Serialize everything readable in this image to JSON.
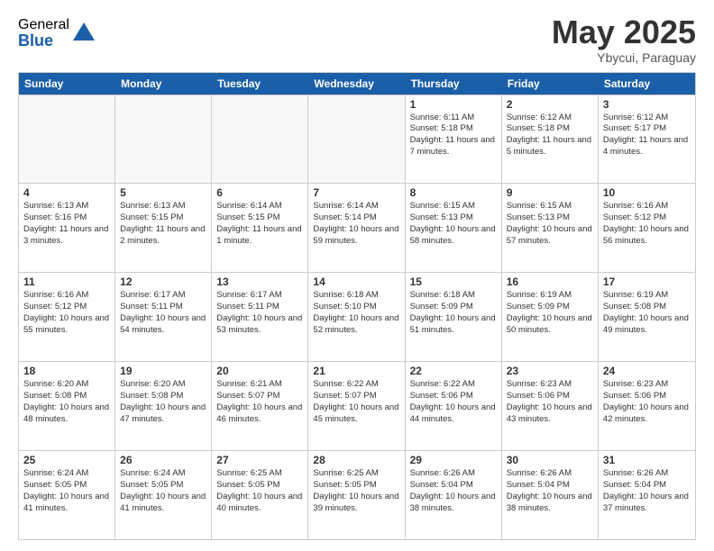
{
  "logo": {
    "general": "General",
    "blue": "Blue"
  },
  "title": "May 2025",
  "subtitle": "Ybycui, Paraguay",
  "header_days": [
    "Sunday",
    "Monday",
    "Tuesday",
    "Wednesday",
    "Thursday",
    "Friday",
    "Saturday"
  ],
  "weeks": [
    [
      {
        "day": "",
        "empty": true
      },
      {
        "day": "",
        "empty": true
      },
      {
        "day": "",
        "empty": true
      },
      {
        "day": "",
        "empty": true
      },
      {
        "day": "1",
        "sunrise": "6:11 AM",
        "sunset": "5:18 PM",
        "daylight": "11 hours and 7 minutes."
      },
      {
        "day": "2",
        "sunrise": "6:12 AM",
        "sunset": "5:18 PM",
        "daylight": "11 hours and 5 minutes."
      },
      {
        "day": "3",
        "sunrise": "6:12 AM",
        "sunset": "5:17 PM",
        "daylight": "11 hours and 4 minutes."
      }
    ],
    [
      {
        "day": "4",
        "sunrise": "6:13 AM",
        "sunset": "5:16 PM",
        "daylight": "11 hours and 3 minutes."
      },
      {
        "day": "5",
        "sunrise": "6:13 AM",
        "sunset": "5:15 PM",
        "daylight": "11 hours and 2 minutes."
      },
      {
        "day": "6",
        "sunrise": "6:14 AM",
        "sunset": "5:15 PM",
        "daylight": "11 hours and 1 minute."
      },
      {
        "day": "7",
        "sunrise": "6:14 AM",
        "sunset": "5:14 PM",
        "daylight": "10 hours and 59 minutes."
      },
      {
        "day": "8",
        "sunrise": "6:15 AM",
        "sunset": "5:13 PM",
        "daylight": "10 hours and 58 minutes."
      },
      {
        "day": "9",
        "sunrise": "6:15 AM",
        "sunset": "5:13 PM",
        "daylight": "10 hours and 57 minutes."
      },
      {
        "day": "10",
        "sunrise": "6:16 AM",
        "sunset": "5:12 PM",
        "daylight": "10 hours and 56 minutes."
      }
    ],
    [
      {
        "day": "11",
        "sunrise": "6:16 AM",
        "sunset": "5:12 PM",
        "daylight": "10 hours and 55 minutes."
      },
      {
        "day": "12",
        "sunrise": "6:17 AM",
        "sunset": "5:11 PM",
        "daylight": "10 hours and 54 minutes."
      },
      {
        "day": "13",
        "sunrise": "6:17 AM",
        "sunset": "5:11 PM",
        "daylight": "10 hours and 53 minutes."
      },
      {
        "day": "14",
        "sunrise": "6:18 AM",
        "sunset": "5:10 PM",
        "daylight": "10 hours and 52 minutes."
      },
      {
        "day": "15",
        "sunrise": "6:18 AM",
        "sunset": "5:09 PM",
        "daylight": "10 hours and 51 minutes."
      },
      {
        "day": "16",
        "sunrise": "6:19 AM",
        "sunset": "5:09 PM",
        "daylight": "10 hours and 50 minutes."
      },
      {
        "day": "17",
        "sunrise": "6:19 AM",
        "sunset": "5:08 PM",
        "daylight": "10 hours and 49 minutes."
      }
    ],
    [
      {
        "day": "18",
        "sunrise": "6:20 AM",
        "sunset": "5:08 PM",
        "daylight": "10 hours and 48 minutes."
      },
      {
        "day": "19",
        "sunrise": "6:20 AM",
        "sunset": "5:08 PM",
        "daylight": "10 hours and 47 minutes."
      },
      {
        "day": "20",
        "sunrise": "6:21 AM",
        "sunset": "5:07 PM",
        "daylight": "10 hours and 46 minutes."
      },
      {
        "day": "21",
        "sunrise": "6:22 AM",
        "sunset": "5:07 PM",
        "daylight": "10 hours and 45 minutes."
      },
      {
        "day": "22",
        "sunrise": "6:22 AM",
        "sunset": "5:06 PM",
        "daylight": "10 hours and 44 minutes."
      },
      {
        "day": "23",
        "sunrise": "6:23 AM",
        "sunset": "5:06 PM",
        "daylight": "10 hours and 43 minutes."
      },
      {
        "day": "24",
        "sunrise": "6:23 AM",
        "sunset": "5:06 PM",
        "daylight": "10 hours and 42 minutes."
      }
    ],
    [
      {
        "day": "25",
        "sunrise": "6:24 AM",
        "sunset": "5:05 PM",
        "daylight": "10 hours and 41 minutes."
      },
      {
        "day": "26",
        "sunrise": "6:24 AM",
        "sunset": "5:05 PM",
        "daylight": "10 hours and 41 minutes."
      },
      {
        "day": "27",
        "sunrise": "6:25 AM",
        "sunset": "5:05 PM",
        "daylight": "10 hours and 40 minutes."
      },
      {
        "day": "28",
        "sunrise": "6:25 AM",
        "sunset": "5:05 PM",
        "daylight": "10 hours and 39 minutes."
      },
      {
        "day": "29",
        "sunrise": "6:26 AM",
        "sunset": "5:04 PM",
        "daylight": "10 hours and 38 minutes."
      },
      {
        "day": "30",
        "sunrise": "6:26 AM",
        "sunset": "5:04 PM",
        "daylight": "10 hours and 38 minutes."
      },
      {
        "day": "31",
        "sunrise": "6:26 AM",
        "sunset": "5:04 PM",
        "daylight": "10 hours and 37 minutes."
      }
    ]
  ],
  "labels": {
    "sunrise": "Sunrise:",
    "sunset": "Sunset:",
    "daylight": "Daylight hours"
  }
}
